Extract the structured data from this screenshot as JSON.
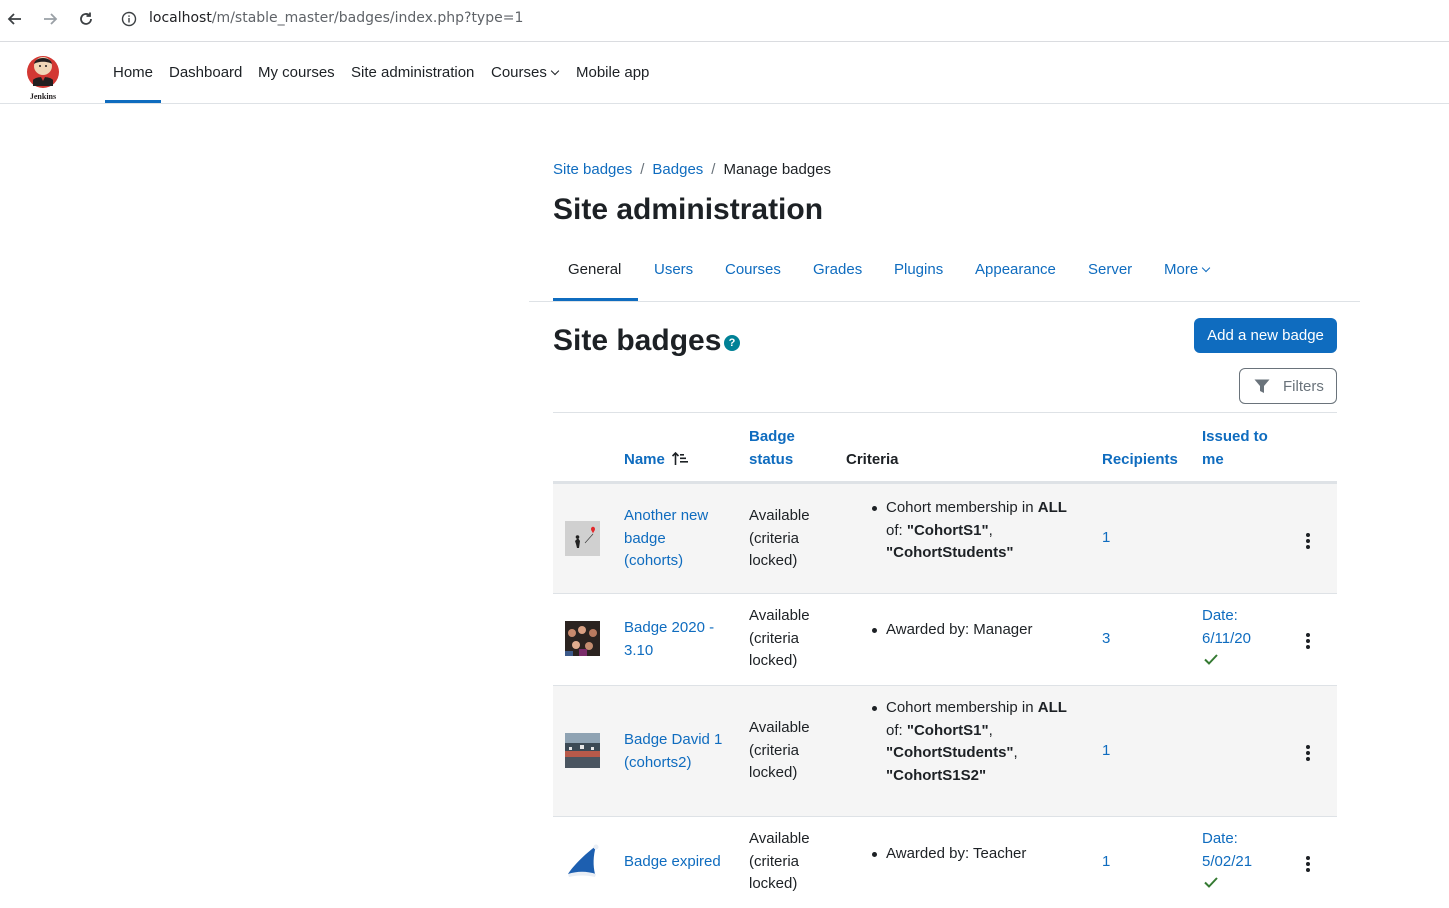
{
  "browser": {
    "url_host": "localhost",
    "url_path": "/m/stable_master/badges/index.php?type=1"
  },
  "navbar": {
    "logo_text": "Jenkins",
    "items": [
      {
        "label": "Home"
      },
      {
        "label": "Dashboard"
      },
      {
        "label": "My courses"
      },
      {
        "label": "Site administration"
      },
      {
        "label": "Courses"
      },
      {
        "label": "Mobile app"
      }
    ]
  },
  "breadcrumb": [
    {
      "label": "Site badges"
    },
    {
      "label": "Badges"
    },
    {
      "label": "Manage badges"
    }
  ],
  "page_title": "Site administration",
  "secondary_nav": [
    {
      "label": "General"
    },
    {
      "label": "Users"
    },
    {
      "label": "Courses"
    },
    {
      "label": "Grades"
    },
    {
      "label": "Plugins"
    },
    {
      "label": "Appearance"
    },
    {
      "label": "Server"
    },
    {
      "label": "More"
    }
  ],
  "section_heading": "Site badges",
  "help_icon_glyph": "?",
  "add_badge_label": "Add a new badge",
  "filters_label": "Filters",
  "table": {
    "headers": {
      "name": "Name",
      "status_line1": "Badge",
      "status_line2": "status",
      "criteria": "Criteria",
      "recipients": "Recipients",
      "issued_line1": "Issued to",
      "issued_line2": "me"
    },
    "rows": [
      {
        "name_lines": [
          "Another new",
          "badge",
          "(cohorts)"
        ],
        "status_lines": [
          "Available",
          "(criteria",
          "locked)"
        ],
        "recipients": "1",
        "issued_date_label": "",
        "issued_date": ""
      },
      {
        "name_lines": [
          "Badge 2020 -",
          "3.10"
        ],
        "status_lines": [
          "Available",
          "(criteria",
          "locked)"
        ],
        "criteria_text": "Awarded by: Manager",
        "recipients": "3",
        "issued_date_label": "Date:",
        "issued_date": "6/11/20"
      },
      {
        "name_lines": [
          "Badge David 1",
          "(cohorts2)"
        ],
        "status_lines": [
          "Available",
          "(criteria",
          "locked)"
        ],
        "recipients": "1",
        "issued_date_label": "",
        "issued_date": ""
      },
      {
        "name_lines": [
          "Badge expired"
        ],
        "status_lines": [
          "Available",
          "(criteria",
          "locked)"
        ],
        "criteria_text": "Awarded by: Teacher",
        "recipients": "1",
        "issued_date_label": "Date:",
        "issued_date": "5/02/21"
      }
    ],
    "cohort_criteria": {
      "prefix": "Cohort membership in",
      "all": "ALL",
      "of": "of:",
      "c1": "\"CohortS1\"",
      "c2": "\"CohortStudents\"",
      "c3": "\"CohortS1S2\"",
      "comma": ","
    }
  },
  "colors": {
    "link": "#0f6cbf",
    "help": "#008196",
    "check": "#357a32"
  }
}
